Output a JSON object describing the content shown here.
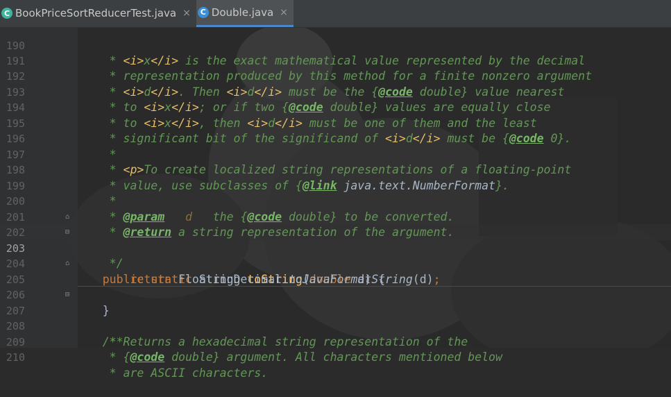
{
  "tabs": [
    {
      "label": "BookPriceSortReducerTest.java",
      "close": "×",
      "icon": "C"
    },
    {
      "label": "Double.java",
      "close": "×",
      "icon": "C"
    }
  ],
  "lines": [
    {
      "n": "190",
      "t": "partial"
    },
    {
      "n": "191"
    },
    {
      "n": "192"
    },
    {
      "n": "193"
    },
    {
      "n": "194"
    },
    {
      "n": "195"
    },
    {
      "n": "196"
    },
    {
      "n": "197"
    },
    {
      "n": "198"
    },
    {
      "n": "199"
    },
    {
      "n": "200"
    },
    {
      "n": "201"
    },
    {
      "n": "202"
    },
    {
      "n": "203"
    },
    {
      "n": "204"
    },
    {
      "n": "205"
    },
    {
      "n": "206"
    },
    {
      "n": "207"
    },
    {
      "n": "208"
    },
    {
      "n": "209"
    },
    {
      "n": "210"
    }
  ],
  "code": {
    "l190a": "     * ",
    "l190b": "<i>",
    "l190c": "x",
    "l190d": "</i>",
    "l190e": " is the exact mathematical value represented by the decimal",
    "l191": "     * representation produced by this method for a finite nonzero argument",
    "l192a": "     * ",
    "l192b": "<i>",
    "l192c": "d",
    "l192d": "</i>",
    "l192e": ". Then ",
    "l192f": "<i>",
    "l192g": "d",
    "l192h": "</i>",
    "l192i": " must be the {",
    "l192j": "@code",
    "l192k": " double} value nearest",
    "l193a": "     * to ",
    "l193b": "<i>",
    "l193c": "x",
    "l193d": "</i>",
    "l193e": "; or if two {",
    "l193f": "@code",
    "l193g": " double} values are equally close",
    "l194a": "     * to ",
    "l194b": "<i>",
    "l194c": "x",
    "l194d": "</i>",
    "l194e": ", then ",
    "l194f": "<i>",
    "l194g": "d",
    "l194h": "</i>",
    "l194i": " must be one of them and the least",
    "l195a": "     * significant bit of the significand of ",
    "l195b": "<i>",
    "l195c": "d",
    "l195d": "</i>",
    "l195e": " must be {",
    "l195f": "@code",
    "l195g": " 0}.",
    "l196": "     *",
    "l197a": "     * ",
    "l197b": "<p>",
    "l197c": "To create localized string representations of a floating-point",
    "l198a": "     * value, use subclasses of {",
    "l198b": "@link",
    "l198c": " java.text.NumberFormat",
    "l198d": "}.",
    "l199": "     *",
    "l200a": "     * ",
    "l200b": "@param",
    "l200c": "   d",
    "l200d": "   the {",
    "l200e": "@code",
    "l200f": " double} to be converted.",
    "l201a": "     * ",
    "l201b": "@return",
    "l201c": " a string representation of the argument.",
    "l202": "     */",
    "l203a": "    ",
    "l203b": "public static",
    "l203c": " String ",
    "l203d": "toString",
    "l203e": "(",
    "l203f": "double",
    "l203g": " d) {",
    "l204a": "        ",
    "l204b": "return",
    "l204c": " FloatingDecimal.",
    "l204d": "toJavaFormatString",
    "l204e": "(d)",
    "l204f": ";",
    "l205": "    }",
    "l206": "",
    "l207": "    /**",
    "l208": "     * Returns a hexadecimal string representation of the",
    "l209a": "     * {",
    "l209b": "@code",
    "l209c": " double} argument. All characters mentioned below",
    "l210": "     * are ASCII characters."
  }
}
